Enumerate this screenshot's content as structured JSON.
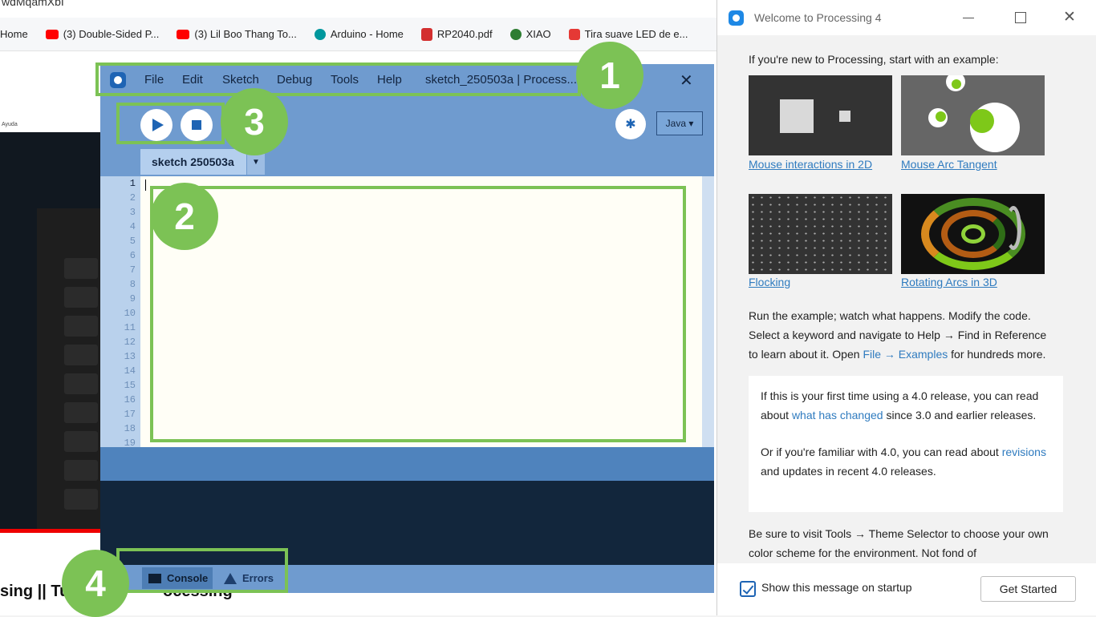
{
  "browser": {
    "url_fragment": "wdMqamXbI",
    "bookmarks": [
      {
        "label": "Home",
        "color": "#4a90e2"
      },
      {
        "label": "(3) Double-Sided P...",
        "color": "#ff0000"
      },
      {
        "label": "(3) Lil Boo Thang To...",
        "color": "#ff0000"
      },
      {
        "label": "Arduino - Home",
        "color": "#00979d"
      },
      {
        "label": "RP2040.pdf",
        "color": "#d32f2f"
      },
      {
        "label": "XIAO",
        "color": "#2e7d32"
      },
      {
        "label": "Tira suave LED de e...",
        "color": "#e53935"
      }
    ],
    "video_caption": "sing || Tut",
    "video_caption_tail": "ocessing",
    "small_text": "Ayuda"
  },
  "ide": {
    "menu": [
      "File",
      "Edit",
      "Sketch",
      "Debug",
      "Tools",
      "Help"
    ],
    "title": "sketch_250503a | Process...",
    "tab_name": "sketch 250503a",
    "mode": "Java ▾",
    "line_numbers": [
      "1",
      "2",
      "3",
      "4",
      "5",
      "6",
      "7",
      "8",
      "9",
      "10",
      "11",
      "12",
      "13",
      "14",
      "15",
      "16",
      "17",
      "18",
      "19"
    ],
    "console_label": "Console",
    "errors_label": "Errors",
    "accent": "#1e64b4",
    "bg": "#6f9bcf"
  },
  "annotations": {
    "badges": [
      "1",
      "2",
      "3",
      "4"
    ],
    "color": "#7cc255"
  },
  "welcome": {
    "title": "Welcome to Processing 4",
    "intro": "If you're new to Processing, start with an example:",
    "examples": [
      "Mouse interactions in 2D",
      "Mouse Arc Tangent",
      "Flocking",
      "Rotating Arcs in 3D"
    ],
    "run_text_1": "Run the example; watch what happens. Modify the code.",
    "run_text_2": "Select a keyword and navigate to Help → Find in Reference",
    "run_text_3a": "to learn about it. Open ",
    "run_text_link": "File → Examples",
    "run_text_3b": " for hundreds more.",
    "box_p1a": "If this is your first time using a 4.0 release, you can read about ",
    "box_p1_link": "what has changed",
    "box_p1b": " since 3.0 and earlier releases.",
    "box_p2a": "Or if you're familiar with 4.0, you can read about ",
    "box_p2_link": "revisions",
    "box_p2b": " and updates in recent 4.0 releases.",
    "theme_text": "Be sure to visit Tools → Theme Selector to choose your own color scheme for the environment. Not fond of",
    "checkbox_label": "Show this message on startup",
    "get_started": "Get Started",
    "link_color": "#2f7bbf"
  }
}
